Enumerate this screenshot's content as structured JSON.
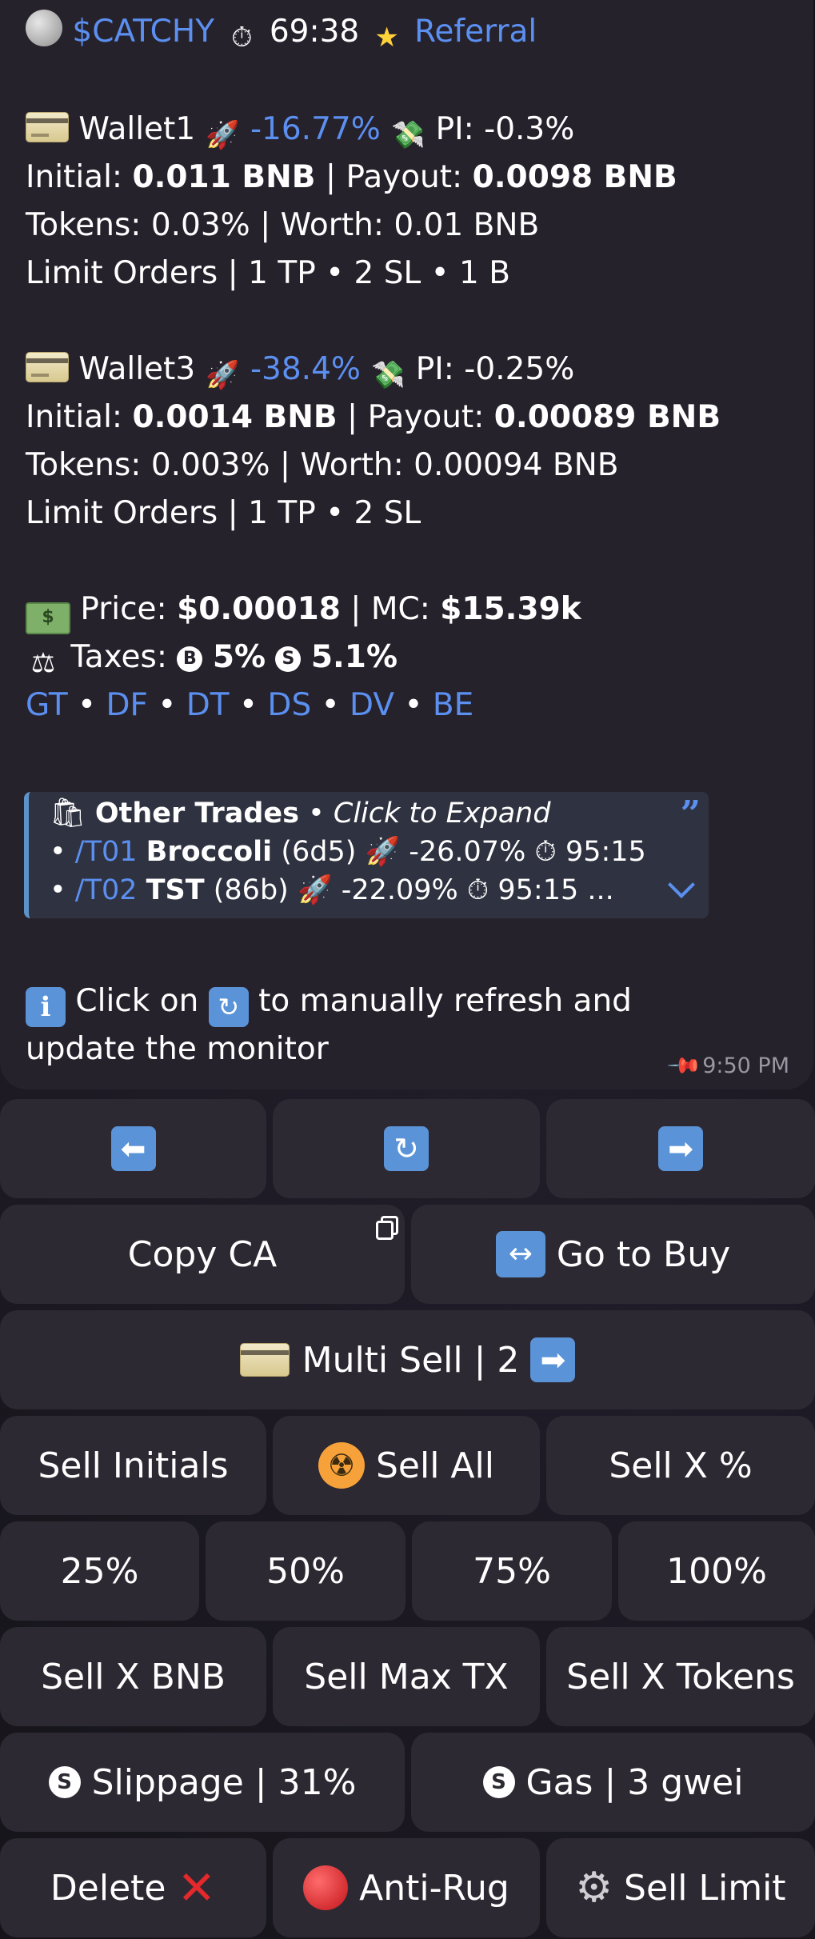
{
  "header": {
    "token": "$CATCHY",
    "timer": "69:38",
    "referral": "Referral"
  },
  "wallets": [
    {
      "name": "Wallet1",
      "change": "-16.77%",
      "pi": "PI: -0.3%",
      "initial_label": "Initial:",
      "initial": "0.011 BNB",
      "payout_label": "| Payout:",
      "payout": "0.0098 BNB",
      "tokens_line": "Tokens: 0.03% | Worth: 0.01 BNB",
      "limit_line": "Limit Orders | 1 TP • 2 SL • 1 B"
    },
    {
      "name": "Wallet3",
      "change": "-38.4%",
      "pi": "PI: -0.25%",
      "initial_label": "Initial:",
      "initial": "0.0014 BNB",
      "payout_label": "| Payout:",
      "payout": "0.00089 BNB",
      "tokens_line": "Tokens: 0.003% | Worth: 0.00094 BNB",
      "limit_line": "Limit Orders | 1 TP • 2 SL"
    }
  ],
  "market": {
    "price_label": "Price:",
    "price": "$0.00018",
    "mc_label": "| MC:",
    "mc": "$15.39k",
    "taxes_label": "Taxes:",
    "buy_tax": "5%",
    "sell_tax": "5.1%",
    "links": [
      "GT",
      "DF",
      "DT",
      "DS",
      "DV",
      "BE"
    ]
  },
  "other_trades": {
    "title": "Other Trades",
    "subtitle": "Click to Expand",
    "rows": [
      {
        "cmd": "/T01",
        "name": "Broccoli",
        "id": "(6d5)",
        "change": "-26.07%",
        "time": "95:15"
      },
      {
        "cmd": "/T02",
        "name": "TST",
        "id": "(86b)",
        "change": "-22.09%",
        "time": "95:15 ..."
      }
    ]
  },
  "footer_note": {
    "part1": "Click on",
    "part2": "to manually refresh and",
    "part3": "update the monitor",
    "time": "9:50 PM"
  },
  "keyboard": {
    "copy_ca": "Copy CA",
    "go_to_buy": "Go to Buy",
    "multi_sell": "Multi Sell | 2",
    "sell_initials": "Sell Initials",
    "sell_all": "Sell All",
    "sell_x_pct": "Sell X %",
    "pct": [
      "25%",
      "50%",
      "75%",
      "100%"
    ],
    "sell_x_bnb": "Sell X BNB",
    "sell_max_tx": "Sell Max TX",
    "sell_x_tokens": "Sell X Tokens",
    "slippage": "Slippage | 31%",
    "gas": "Gas | 3 gwei",
    "delete": "Delete",
    "anti_rug": "Anti-Rug",
    "sell_limit": "Sell Limit"
  },
  "colors": {
    "link": "#5b8ff0",
    "bubble": "#26222c",
    "button": "#2d2932",
    "quote_bar": "#5e93c9"
  }
}
